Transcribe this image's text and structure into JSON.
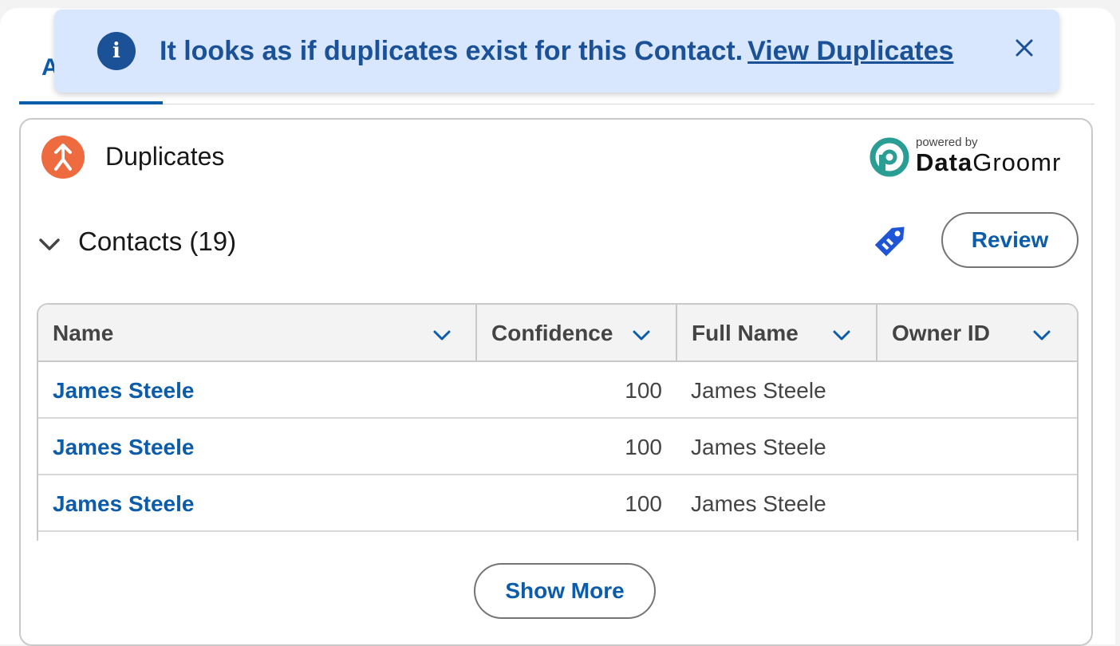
{
  "tabs": {
    "active_label": "A"
  },
  "toast": {
    "message": "It looks as if duplicates exist for this Contact.",
    "link": "View Duplicates",
    "info_icon": "info-icon",
    "close_icon": "close-icon",
    "background": "#d8e6fe",
    "text_color": "#1b5297"
  },
  "card": {
    "title": "Duplicates",
    "icon": "merge-icon",
    "icon_color": "#ee6a3f",
    "brand": {
      "powered": "powered by",
      "name_bold": "Data",
      "name_regular": "Groomr",
      "logo": "datagroomr-logo-icon"
    }
  },
  "section": {
    "title": "Contacts (19)",
    "tag_icon": "tag-icon",
    "review_label": "Review"
  },
  "table": {
    "columns": [
      "Name",
      "Confidence",
      "Full Name",
      "Owner ID"
    ],
    "rows": [
      {
        "name": "James Steele",
        "confidence": "100",
        "full_name": "James Steele",
        "owner_id": ""
      },
      {
        "name": "James Steele",
        "confidence": "100",
        "full_name": "James Steele",
        "owner_id": ""
      },
      {
        "name": "James Steele",
        "confidence": "100",
        "full_name": "James Steele",
        "owner_id": ""
      }
    ]
  },
  "footer": {
    "show_more_label": "Show More"
  },
  "colors": {
    "link": "#0b5cab",
    "border": "#c9c9c9",
    "header_bg": "#f3f3f3"
  }
}
